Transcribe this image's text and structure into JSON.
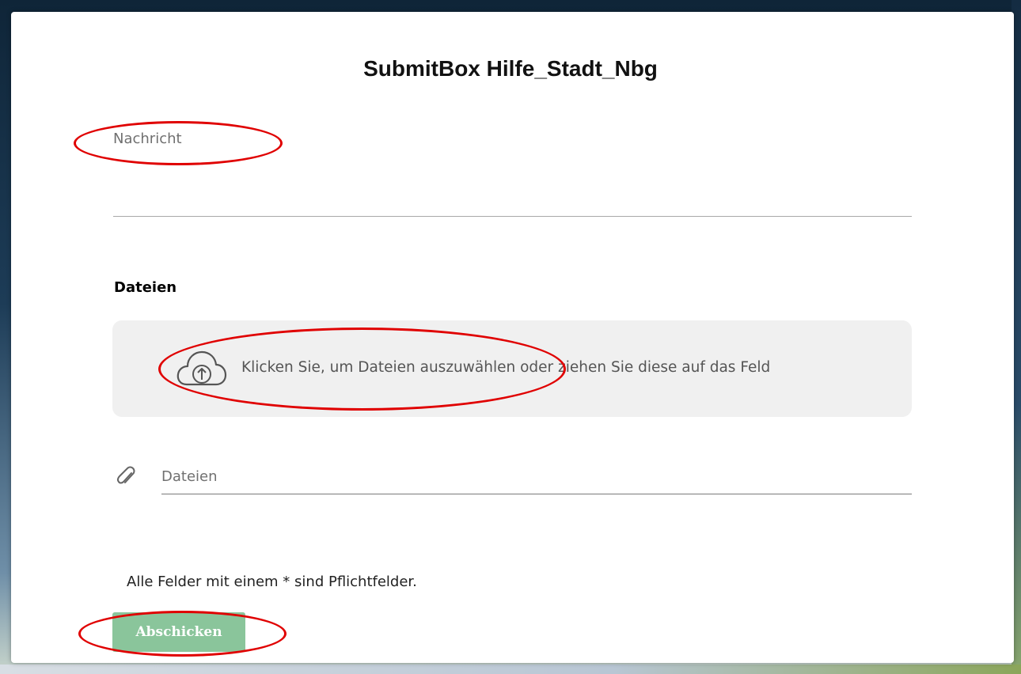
{
  "form": {
    "title": "SubmitBox Hilfe_Stadt_Nbg",
    "message_placeholder": "Nachricht",
    "files_section_title": "Dateien",
    "dropzone_text": "Klicken Sie, um Dateien auszuwählen oder ziehen Sie diese auf das Feld",
    "dropzone_icon": "cloud-upload-icon",
    "files_field_label": "Dateien",
    "files_field_icon": "paperclip-icon",
    "required_note": "Alle Felder mit einem * sind Pflichtfelder.",
    "submit_label": "Abschicken"
  },
  "colors": {
    "submit_button_bg": "#8ac59b",
    "annotation": "#e00000",
    "dropzone_bg": "#f0f0f0"
  }
}
